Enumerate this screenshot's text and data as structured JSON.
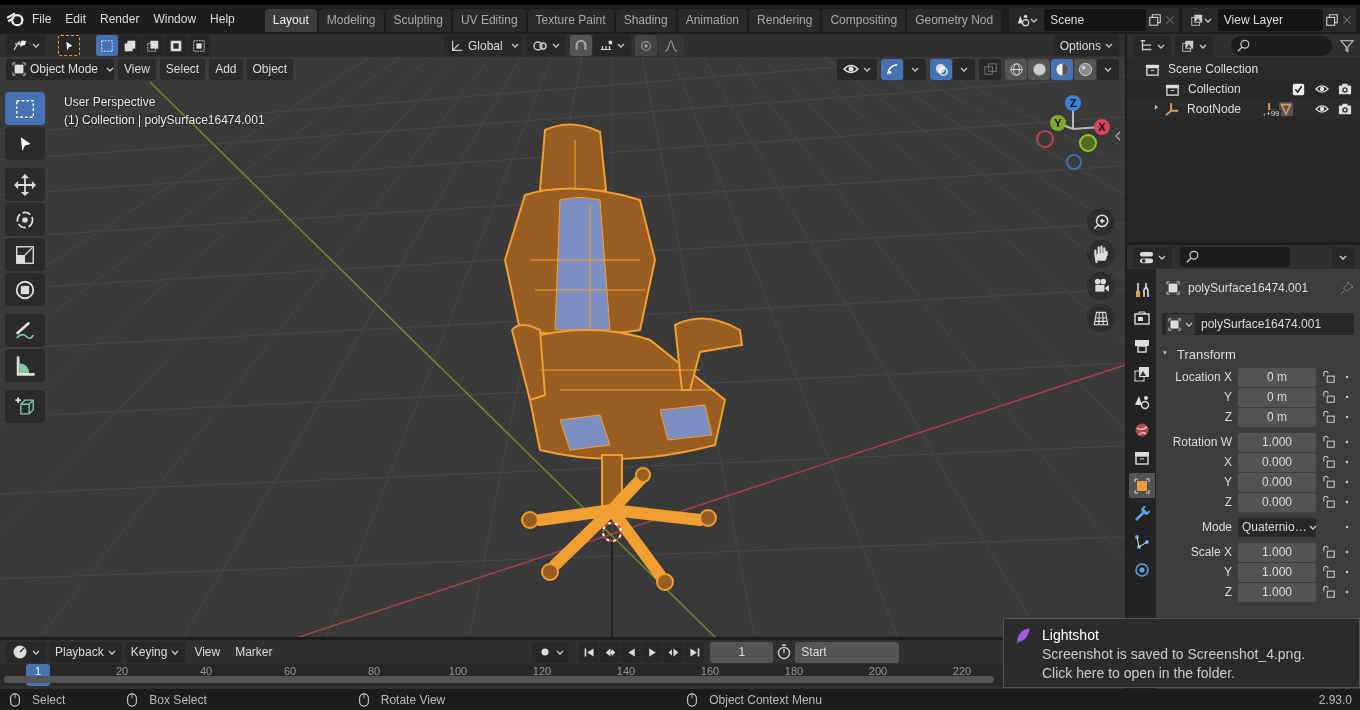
{
  "menu": [
    "File",
    "Edit",
    "Render",
    "Window",
    "Help"
  ],
  "workspaces": [
    {
      "label": "Layout",
      "selected": true
    },
    {
      "label": "Modeling",
      "selected": false
    },
    {
      "label": "Sculpting",
      "selected": false
    },
    {
      "label": "UV Editing",
      "selected": false
    },
    {
      "label": "Texture Paint",
      "selected": false
    },
    {
      "label": "Shading",
      "selected": false
    },
    {
      "label": "Animation",
      "selected": false
    },
    {
      "label": "Rendering",
      "selected": false
    },
    {
      "label": "Compositing",
      "selected": false
    },
    {
      "label": "Geometry Nod",
      "selected": false
    }
  ],
  "scene": "Scene",
  "view_layer": "View Layer",
  "tool_header": {
    "orientation": "Global",
    "options": "Options",
    "select_modes": [
      {
        "selected": true
      },
      {
        "selected": false
      },
      {
        "selected": false
      },
      {
        "selected": false
      },
      {
        "selected": false
      }
    ]
  },
  "viewport_header": {
    "mode": "Object Mode",
    "menus": [
      "View",
      "Select",
      "Add",
      "Object"
    ],
    "gizmos_on": true,
    "overlays_on": true,
    "xray_on": false,
    "shading": [
      {
        "selected": false
      },
      {
        "selected": false
      },
      {
        "selected": true
      },
      {
        "selected": false
      }
    ]
  },
  "viewport_info": [
    "User Perspective",
    "(1) Collection | polySurface16474.001"
  ],
  "tools": [
    {
      "selected": true
    },
    {
      "selected": false
    },
    {
      "selected": false
    },
    {
      "selected": false
    },
    {
      "selected": false
    },
    {
      "selected": false
    },
    {
      "selected": false
    },
    {
      "selected": false
    },
    {
      "selected": false
    }
  ],
  "gizmo_axes": [
    "Z",
    "Y",
    "X"
  ],
  "outliner": {
    "items": [
      {
        "label": "Scene Collection",
        "children": [
          {
            "label": "Collection",
            "checked": true
          },
          {
            "label": "RootNode",
            "expanded": false,
            "badge": "+99"
          }
        ]
      }
    ]
  },
  "properties": {
    "tabs": [
      {
        "selected": false
      },
      {
        "selected": false
      },
      {
        "selected": false
      },
      {
        "selected": false
      },
      {
        "selected": false
      },
      {
        "selected": false
      },
      {
        "selected": false
      },
      {
        "selected": true
      },
      {
        "selected": false
      },
      {
        "selected": false
      },
      {
        "selected": false
      }
    ],
    "object_name": "polySurface16474.001",
    "data_name": "polySurface16474.001",
    "panel": {
      "title": "Transform",
      "expanded": true
    },
    "groups": [
      [
        {
          "label": "Location X",
          "value": "0 m",
          "kind": "number"
        },
        {
          "label": "Y",
          "value": "0 m",
          "kind": "number"
        },
        {
          "label": "Z",
          "value": "0 m",
          "kind": "number"
        }
      ],
      [
        {
          "label": "Rotation W",
          "value": "1.000",
          "kind": "number"
        },
        {
          "label": "X",
          "value": "0.000",
          "kind": "number"
        },
        {
          "label": "Y",
          "value": "0.000",
          "kind": "number"
        },
        {
          "label": "Z",
          "value": "0.000",
          "kind": "number"
        }
      ],
      [
        {
          "label": "Mode",
          "value": "Quaternio…",
          "kind": "dropdown"
        }
      ],
      [
        {
          "label": "Scale X",
          "value": "1.000",
          "kind": "number"
        },
        {
          "label": "Y",
          "value": "1.000",
          "kind": "number"
        },
        {
          "label": "Z",
          "value": "1.000",
          "kind": "number"
        }
      ]
    ]
  },
  "timeline": {
    "menus": [
      "Playback",
      "Keying",
      "View",
      "Marker"
    ],
    "current_frame": "1",
    "start_label": "Start",
    "ruler": [
      "1",
      "20",
      "40",
      "60",
      "80",
      "100",
      "120",
      "140",
      "160",
      "180",
      "200",
      "220"
    ]
  },
  "status_bar": {
    "hints": [
      "Select",
      "Box Select",
      "Rotate View",
      "Object Context Menu"
    ],
    "version": "2.93.0"
  },
  "notification": {
    "app": "Lightshot",
    "lines": [
      "Screenshot is saved to Screenshot_4.png.",
      "Click here to open in the folder."
    ]
  }
}
